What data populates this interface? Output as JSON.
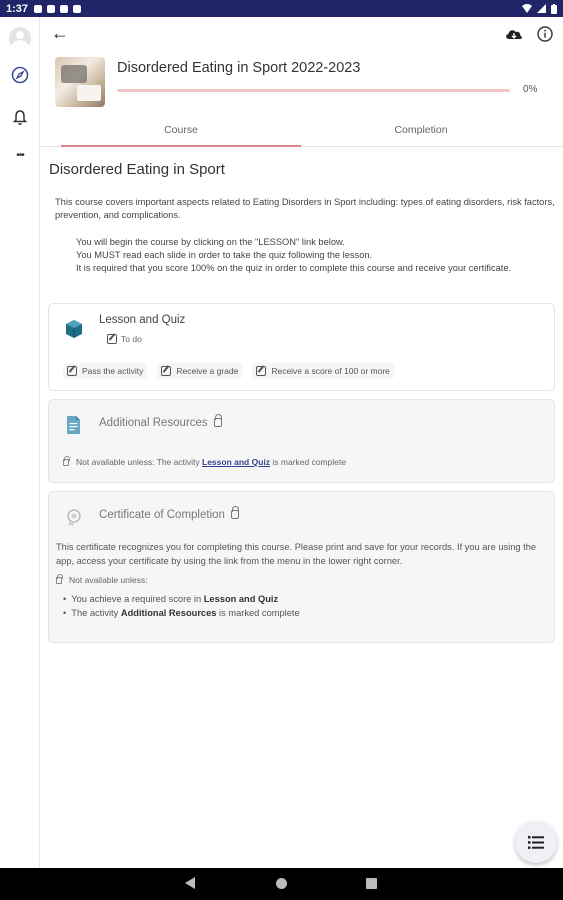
{
  "status_bar": {
    "time": "1:37"
  },
  "nav_rail": {
    "items": [
      {
        "name": "avatar"
      },
      {
        "name": "compass-icon"
      },
      {
        "name": "bell-icon"
      },
      {
        "name": "more-icon",
        "label": "•••"
      }
    ]
  },
  "header": {
    "back_symbol": "←"
  },
  "course": {
    "title": "Disordered Eating in Sport 2022-2023",
    "progress_percent": 0,
    "progress_label": "0%"
  },
  "tabs": [
    {
      "label": "Course",
      "active": true
    },
    {
      "label": "Completion",
      "active": false
    }
  ],
  "section": {
    "title": "Disordered Eating in Sport",
    "summary_1": "This course covers important aspects related to Eating Disorders in Sport including: types of eating disorders, risk factors, prevention, and complications.",
    "summary_2": "You will begin the course by clicking on the \"LESSON\" link below.",
    "summary_3": "You MUST read each slide in order to take the quiz following the lesson.",
    "summary_4": "It is required that you score 100% on the quiz in order to complete this course and receive your certificate."
  },
  "modules": {
    "lesson": {
      "title": "Lesson and Quiz",
      "status": "To do",
      "conditions": [
        "Pass the activity",
        "Receive a grade",
        "Receive a score of 100 or more"
      ]
    },
    "resources": {
      "title": "Additional Resources",
      "restriction_prefix": "Not available unless: The activity ",
      "restriction_link": "Lesson and Quiz",
      "restriction_suffix": " is marked complete"
    },
    "certificate": {
      "title": "Certificate of Completion",
      "description": "This certificate recognizes you for completing this course.  Please print and save for your records.  If you are using the app, access your certificate by using the link from the menu in the lower right corner.",
      "restriction_label": "Not available unless:",
      "req_1_prefix": "You achieve a required score in ",
      "req_1_bold": "Lesson and Quiz",
      "req_2_prefix": "The activity ",
      "req_2_bold": "Additional Resources",
      "req_2_suffix": " is marked complete"
    }
  },
  "colors": {
    "status_bar": "#1f2567",
    "accent": "#d86a70",
    "progress_track": "#f2c4c6",
    "lesson_icon": "#1f6f8b",
    "link": "#3b3f8f"
  }
}
